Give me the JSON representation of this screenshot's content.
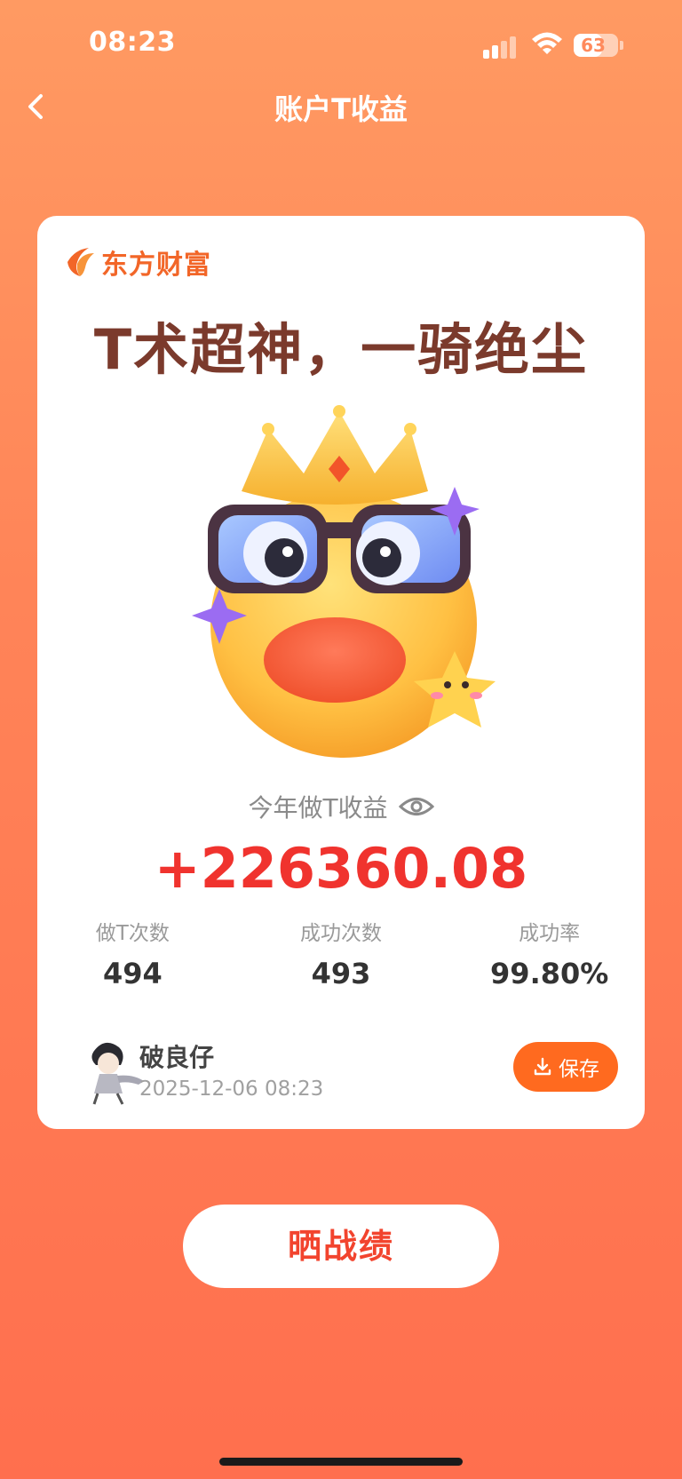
{
  "status": {
    "time": "08:23",
    "battery": "63",
    "battery_level": 63
  },
  "nav": {
    "title": "账户T收益"
  },
  "card": {
    "brand": "东方财富",
    "headline": "T术超神，一骑绝尘",
    "stat_label": "今年做T收益",
    "amount": "+226360.08",
    "metrics": [
      {
        "label": "做T次数",
        "value": "494"
      },
      {
        "label": "成功次数",
        "value": "493"
      },
      {
        "label": "成功率",
        "value": "99.80%"
      }
    ],
    "user": {
      "name": "破良仔",
      "time": "2025-12-06 08:23"
    },
    "save_label": "保存"
  },
  "share_label": "晒战绩",
  "colors": {
    "accent": "#ff6a1f",
    "amount": "#f0332e",
    "headline": "#7b3a2c",
    "brand": "#f26628"
  },
  "icons": [
    "back-chevron-icon",
    "eye-icon",
    "download-icon",
    "brand-logo-icon",
    "wifi-icon",
    "signal-icon",
    "battery-icon"
  ]
}
